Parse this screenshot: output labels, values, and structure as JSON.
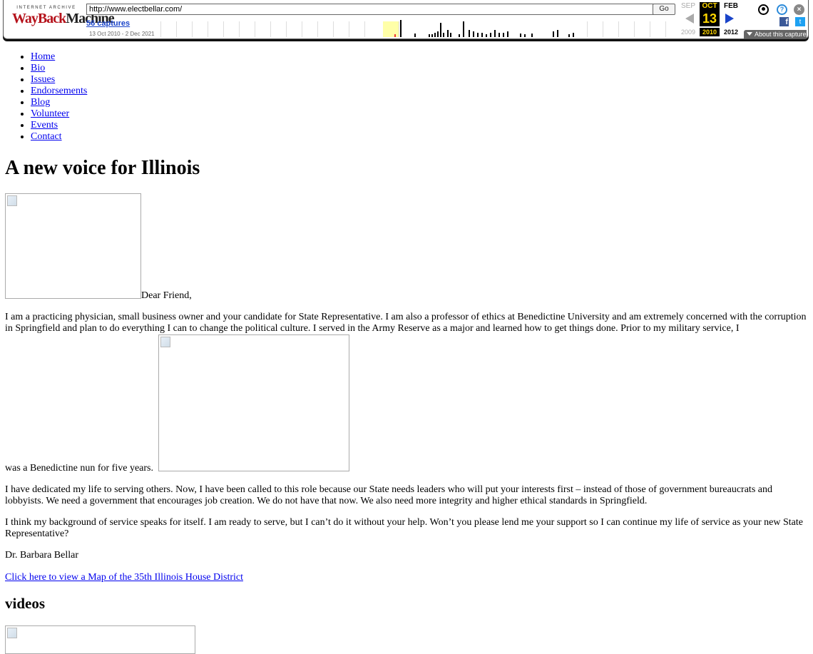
{
  "toolbar": {
    "logo_top": "INTERNET ARCHIVE",
    "logo_wayback": "WayBack",
    "logo_machine": "Machine",
    "url": "http://www.electbellar.com/",
    "go_label": "Go",
    "captures_label": "56 captures",
    "date_range": "13 Oct 2010 - 2 Dec 2021",
    "prev_month": "SEP",
    "current_month": "OCT",
    "next_month": "FEB",
    "current_day": "13",
    "prev_year": "2009",
    "current_year": "2010",
    "next_year": "2012",
    "about_label": "About this capture",
    "facebook_glyph": "f",
    "twitter_glyph": "t",
    "help_glyph": "?",
    "close_glyph": "×",
    "icons": [
      "user-icon",
      "help-icon",
      "close-icon",
      "facebook-icon",
      "twitter-icon",
      "prev-arrow-icon",
      "next-arrow-icon"
    ]
  },
  "nav": {
    "items": [
      "Home",
      "Bio",
      "Issues",
      "Endorsements",
      "Blog",
      "Volunteer",
      "Events",
      "Contact"
    ]
  },
  "main": {
    "heading": "A new voice for Illinois",
    "greeting": "Dear Friend,",
    "para1_start": "I am a practicing physician, small business owner and your candidate for State Representative. I am also a professor of ethics at Benedictine University and am extremely concerned with the corruption in Springfield and plan to do everything I can to change the political culture. I served in the Army Reserve as a major and learned how to get things done. Prior to my military service, I",
    "para1_end": "was a Benedictine nun for five years.",
    "para2": "I have dedicated my life to serving others. Now, I have been called to this role because our State needs leaders who will put your interests first – instead of those of government bureaucrats and lobbyists. We need a government that encourages job creation. We do not have that now. We also need more integrity and higher ethical standards in Springfield.",
    "para3": "I think my background of service speaks for itself. I am ready to serve, but I can’t do it without your help. Won’t you please lend me your support so I can continue my life of service as your new State Representative?",
    "signature": "Dr. Barbara Bellar",
    "map_link": "Click here to view a Map of the 35th Illinois House District",
    "videos_heading": "videos"
  }
}
